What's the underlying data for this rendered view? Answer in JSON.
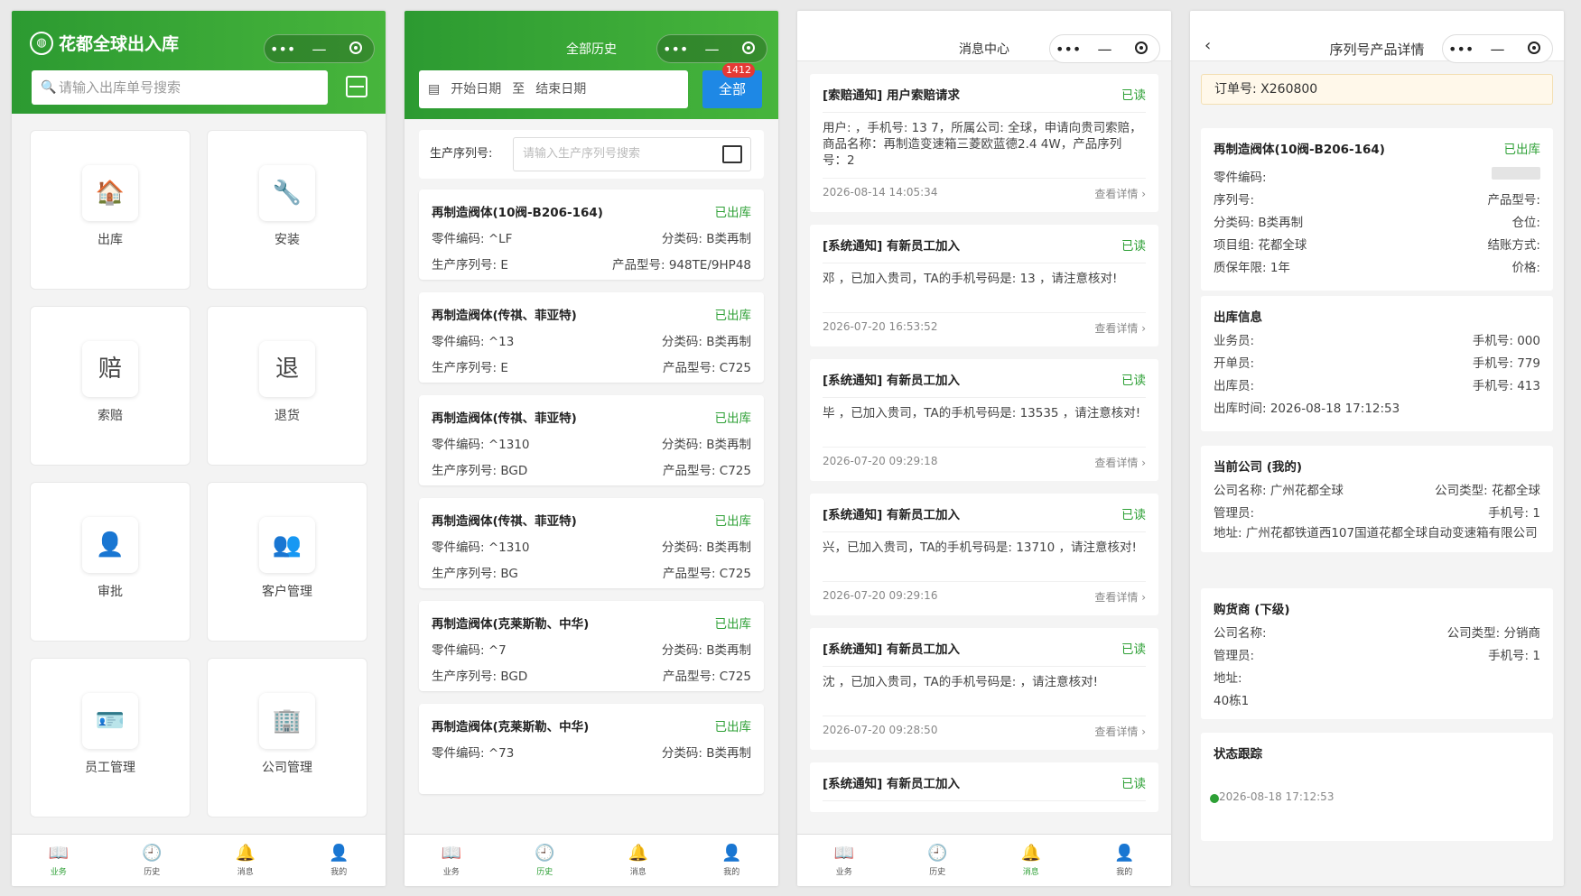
{
  "panel1": {
    "brand": "花都全球出入库",
    "search_placeholder": "请输入出库单号搜索",
    "tiles": [
      {
        "label": "出库",
        "icon": "warehouse-out-icon",
        "glyph": "🏠"
      },
      {
        "label": "安装",
        "icon": "wrench-icon",
        "glyph": "🔧"
      },
      {
        "label": "索赔",
        "icon": "claim-icon",
        "glyph": "赔"
      },
      {
        "label": "退货",
        "icon": "return-icon",
        "glyph": "退"
      },
      {
        "label": "审批",
        "icon": "stamp-icon",
        "glyph": "👤"
      },
      {
        "label": "客户管理",
        "icon": "customers-icon",
        "glyph": "👥"
      },
      {
        "label": "员工管理",
        "icon": "employee-icon",
        "glyph": "🪪"
      },
      {
        "label": "公司管理",
        "icon": "building-icon",
        "glyph": "🏢"
      }
    ]
  },
  "tabs": [
    {
      "label": "业务",
      "glyph": "📖"
    },
    {
      "label": "历史",
      "glyph": "🕘"
    },
    {
      "label": "消息",
      "glyph": "🔔"
    },
    {
      "label": "我的",
      "glyph": "👤"
    }
  ],
  "panel2": {
    "title": "全部历史",
    "start_date": "开始日期",
    "to": "至",
    "end_date": "结束日期",
    "all_label": "全部",
    "badge": "1412",
    "serial_label": "生产序列号:",
    "serial_placeholder": "请输入生产序列号搜索",
    "items": [
      {
        "name": "再制造阀体(10阀-B206-164)",
        "status": "已出库",
        "part": "零件编码: ^LF",
        "cls": "分类码: B类再制",
        "serial": "生产序列号: E",
        "model": "产品型号: 948TE/9HP48"
      },
      {
        "name": "再制造阀体(传祺、菲亚特)",
        "status": "已出库",
        "part": "零件编码: ^13",
        "cls": "分类码: B类再制",
        "serial": "生产序列号: E",
        "model": "产品型号: C725"
      },
      {
        "name": "再制造阀体(传祺、菲亚特)",
        "status": "已出库",
        "part": "零件编码: ^1310",
        "cls": "分类码: B类再制",
        "serial": "生产序列号: BGD",
        "model": "产品型号: C725"
      },
      {
        "name": "再制造阀体(传祺、菲亚特)",
        "status": "已出库",
        "part": "零件编码: ^1310",
        "cls": "分类码: B类再制",
        "serial": "生产序列号: BG",
        "model": "产品型号: C725"
      },
      {
        "name": "再制造阀体(克莱斯勒、中华)",
        "status": "已出库",
        "part": "零件编码: ^7",
        "cls": "分类码: B类再制",
        "serial": "生产序列号: BGD",
        "model": "产品型号: C725"
      },
      {
        "name": "再制造阀体(克莱斯勒、中华)",
        "status": "已出库",
        "part": "零件编码: ^73",
        "cls": "分类码: B类再制",
        "serial": "",
        "model": ""
      }
    ]
  },
  "panel3": {
    "title": "消息中心",
    "detail": "查看详情 ›",
    "messages": [
      {
        "title": "[索赔通知] 用户索赔请求",
        "read": "已读",
        "body": "用户: ，手机号: 13 7，所属公司: 全球，申请向贵司索赔，商品名称：再制造变速箱三菱欧蓝德2.4 4W，产品序列号：2",
        "time": "2026-08-14 14:05:34"
      },
      {
        "title": "[系统通知] 有新员工加入",
        "read": "已读",
        "body": "邓 ，已加入贵司，TA的手机号码是: 13 ，请注意核对!",
        "time": "2026-07-20 16:53:52"
      },
      {
        "title": "[系统通知] 有新员工加入",
        "read": "已读",
        "body": "毕 ，已加入贵司，TA的手机号码是: 13535 ，请注意核对!",
        "time": "2026-07-20 09:29:18"
      },
      {
        "title": "[系统通知] 有新员工加入",
        "read": "已读",
        "body": "兴，已加入贵司，TA的手机号码是: 13710 ，请注意核对!",
        "time": "2026-07-20 09:29:16"
      },
      {
        "title": "[系统通知] 有新员工加入",
        "read": "已读",
        "body": "沈 ，已加入贵司，TA的手机号码是: ，请注意核对!",
        "time": "2026-07-20 09:28:50"
      },
      {
        "title": "[系统通知] 有新员工加入",
        "read": "已读",
        "body": "",
        "time": ""
      }
    ]
  },
  "panel4": {
    "title": "序列号产品详情",
    "order": "订单号: X260800",
    "product": {
      "name": "再制造阀体(10阀-B206-164)",
      "status": "已出库",
      "part": "零件编码:",
      "serial": "序列号:",
      "model": "产品型号:",
      "cls": "分类码: B类再制",
      "bin": "仓位:",
      "group": "项目组: 花都全球",
      "settle": "结账方式:",
      "warranty": "质保年限: 1年",
      "price": "价格:"
    },
    "outbound": {
      "heading": "出库信息",
      "sales": "业务员:",
      "sales_phone": "手机号:",
      "sales_tail": "000",
      "opener": "开单员:",
      "opener_phone": "手机号:",
      "opener_tail": "779",
      "issuer": "出库员:",
      "issuer_phone": "手机号:",
      "issuer_tail": "413",
      "time": "出库时间: 2026-08-18 17:12:53"
    },
    "company": {
      "heading": "当前公司 (我的)",
      "name": "公司名称: 广州花都全球",
      "type": "公司类型: 花都全球",
      "manager": "管理员:",
      "phone": "手机号: 1",
      "address": "地址: 广州花都铁道西107国道花都全球自动变速箱有限公司"
    },
    "buyer": {
      "heading": "购货商 (下级)",
      "name": "公司名称:",
      "type": "公司类型: 分销商",
      "manager": "管理员:",
      "phone": "手机号: 1",
      "address": "地址:",
      "address2": "40栋1"
    },
    "tracking": {
      "heading": "状态跟踪",
      "time": "2026-08-18 17:12:53"
    }
  }
}
